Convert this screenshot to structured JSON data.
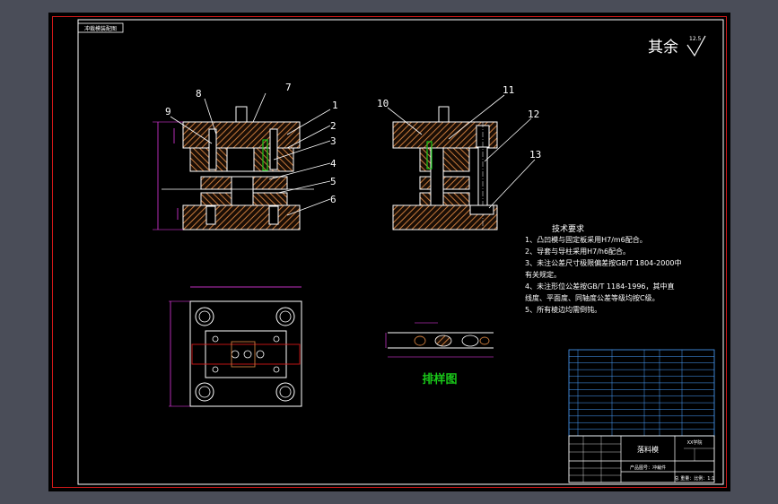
{
  "corner_tag": "冲裁模装配图",
  "roughness": {
    "label": "其余",
    "value": "12.5"
  },
  "part_numbers": [
    "1",
    "2",
    "3",
    "4",
    "5",
    "6",
    "7",
    "8",
    "9",
    "10",
    "11",
    "12",
    "13"
  ],
  "strip_label": "排样图",
  "requirements": {
    "title": "技术要求",
    "items": [
      "1、凸凹模与固定板采用H7/m6配合。",
      "2、导套与导柱采用H7/h6配合。",
      "3、未注公差尺寸极限偏差按GB/T 1804-2000中",
      "    有关规定。",
      "4、未注形位公差按GB/T 1184-1996，其中直",
      "    线度、平面度、同轴度公差等级均按C级。",
      "5、所有棱边均需倒钝。"
    ]
  },
  "title_block": {
    "drawing_name": "落料模",
    "school": "XX学院",
    "footer_left": "产品图号：冲裁件",
    "footer_right": "总 重量：比例：1:1"
  },
  "colors": {
    "background": "#000000",
    "frame": "#d01818",
    "lines": "#ffffff",
    "hatch": "#c87a3c",
    "leaders": "#ffffff",
    "dims": "#ff40ff",
    "green": "#19c819",
    "table": "#4aa0ff"
  }
}
